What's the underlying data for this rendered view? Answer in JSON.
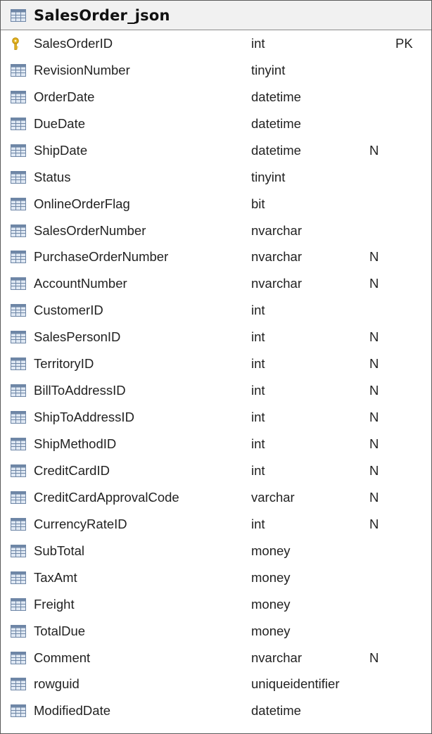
{
  "table": {
    "title": "SalesOrder_json",
    "columns": [
      {
        "name": "SalesOrderID",
        "type": "int",
        "nullable": "",
        "key": "PK",
        "icon": "key-icon"
      },
      {
        "name": "RevisionNumber",
        "type": "tinyint",
        "nullable": "",
        "key": "",
        "icon": "column-icon"
      },
      {
        "name": "OrderDate",
        "type": "datetime",
        "nullable": "",
        "key": "",
        "icon": "column-icon"
      },
      {
        "name": "DueDate",
        "type": "datetime",
        "nullable": "",
        "key": "",
        "icon": "column-icon"
      },
      {
        "name": "ShipDate",
        "type": "datetime",
        "nullable": "N",
        "key": "",
        "icon": "column-icon"
      },
      {
        "name": "Status",
        "type": "tinyint",
        "nullable": "",
        "key": "",
        "icon": "column-icon"
      },
      {
        "name": "OnlineOrderFlag",
        "type": "bit",
        "nullable": "",
        "key": "",
        "icon": "column-icon"
      },
      {
        "name": "SalesOrderNumber",
        "type": "nvarchar",
        "nullable": "",
        "key": "",
        "icon": "column-icon"
      },
      {
        "name": "PurchaseOrderNumber",
        "type": "nvarchar",
        "nullable": "N",
        "key": "",
        "icon": "column-icon"
      },
      {
        "name": "AccountNumber",
        "type": "nvarchar",
        "nullable": "N",
        "key": "",
        "icon": "column-icon"
      },
      {
        "name": "CustomerID",
        "type": "int",
        "nullable": "",
        "key": "",
        "icon": "column-icon"
      },
      {
        "name": "SalesPersonID",
        "type": "int",
        "nullable": "N",
        "key": "",
        "icon": "column-icon"
      },
      {
        "name": "TerritoryID",
        "type": "int",
        "nullable": "N",
        "key": "",
        "icon": "column-icon"
      },
      {
        "name": "BillToAddressID",
        "type": "int",
        "nullable": "N",
        "key": "",
        "icon": "column-icon"
      },
      {
        "name": "ShipToAddressID",
        "type": "int",
        "nullable": "N",
        "key": "",
        "icon": "column-icon"
      },
      {
        "name": "ShipMethodID",
        "type": "int",
        "nullable": "N",
        "key": "",
        "icon": "column-icon"
      },
      {
        "name": "CreditCardID",
        "type": "int",
        "nullable": "N",
        "key": "",
        "icon": "column-icon"
      },
      {
        "name": "CreditCardApprovalCode",
        "type": "varchar",
        "nullable": "N",
        "key": "",
        "icon": "column-icon"
      },
      {
        "name": "CurrencyRateID",
        "type": "int",
        "nullable": "N",
        "key": "",
        "icon": "column-icon"
      },
      {
        "name": "SubTotal",
        "type": "money",
        "nullable": "",
        "key": "",
        "icon": "column-icon"
      },
      {
        "name": "TaxAmt",
        "type": "money",
        "nullable": "",
        "key": "",
        "icon": "column-icon"
      },
      {
        "name": "Freight",
        "type": "money",
        "nullable": "",
        "key": "",
        "icon": "column-icon"
      },
      {
        "name": "TotalDue",
        "type": "money",
        "nullable": "",
        "key": "",
        "icon": "column-icon"
      },
      {
        "name": "Comment",
        "type": "nvarchar",
        "nullable": "N",
        "key": "",
        "icon": "column-icon"
      },
      {
        "name": "rowguid",
        "type": "uniqueidentifier",
        "nullable": "",
        "key": "",
        "icon": "column-icon"
      },
      {
        "name": "ModifiedDate",
        "type": "datetime",
        "nullable": "",
        "key": "",
        "icon": "column-icon"
      }
    ]
  },
  "colors": {
    "icon_header": "#3f5f8c",
    "icon_cell": "#dfe8f3",
    "icon_border": "#6e86a6",
    "key_gold": "#e2b21e"
  }
}
